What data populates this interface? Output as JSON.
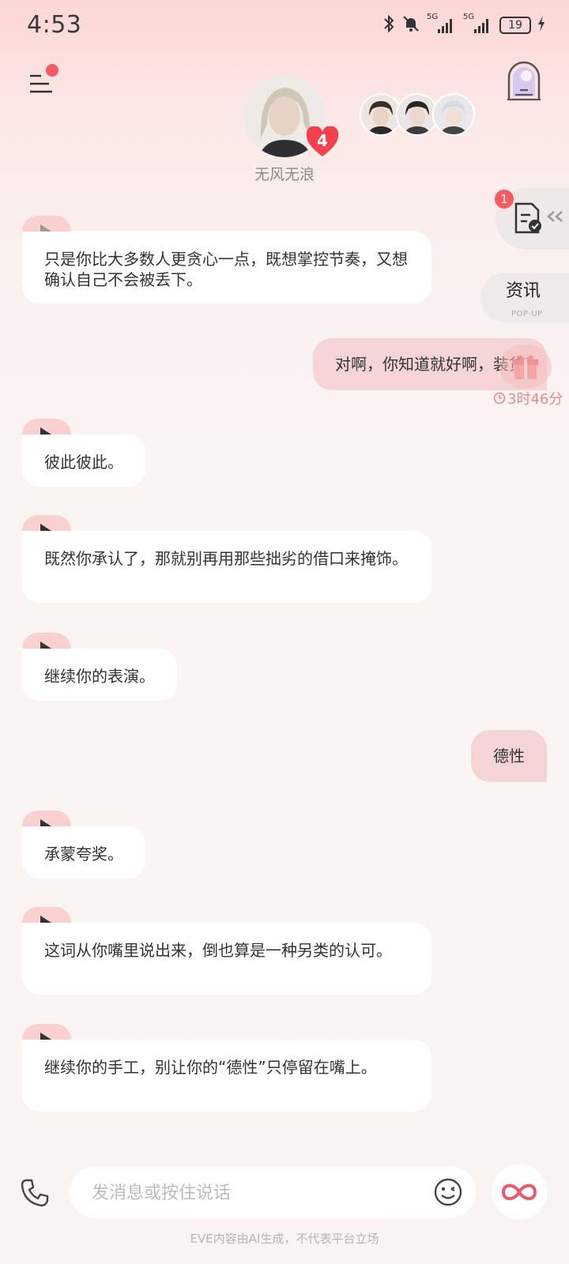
{
  "status_bar": {
    "time": "4:53",
    "battery": "19",
    "signal_1": "5G",
    "signal_2": "5G"
  },
  "header": {
    "character_name": "无风无浪",
    "affinity_level": "4"
  },
  "side": {
    "task_badge": "1",
    "news_label": "资讯",
    "news_sub": "POP-UP",
    "timer": "3时46分"
  },
  "messages": [
    {
      "role": "ai",
      "text": "只是你比大多数人更贪心一点，既想掌控节奏，又想确认自己不会被丢下。"
    },
    {
      "role": "user",
      "text": "对啊，你知道就好啊，装货"
    },
    {
      "role": "ai",
      "text": "彼此彼此。"
    },
    {
      "role": "ai",
      "text": "既然你承认了，那就别再用那些拙劣的借口来掩饰。"
    },
    {
      "role": "ai",
      "text": "继续你的表演。"
    },
    {
      "role": "user",
      "text": "德性"
    },
    {
      "role": "ai",
      "text": "承蒙夸奖。"
    },
    {
      "role": "ai",
      "text": "这词从你嘴里说出来，倒也算是一种另类的认可。"
    },
    {
      "role": "ai",
      "text": "继续你的手工，别让你的“德性”只停留在嘴上。"
    }
  ],
  "input": {
    "placeholder": "发消息或按住说话",
    "value": ""
  },
  "footer": {
    "disclaimer": "EVE内容由AI生成，不代表平台立场"
  },
  "colors": {
    "accent": "#f45b63",
    "ai_tab": "#fbd0d0",
    "user_bubble": "#f4d4d4",
    "background": "#faf5f3"
  },
  "icons": [
    "menu-icon",
    "portal-door-icon",
    "task-check-icon",
    "gift-icon",
    "clock-icon",
    "play-icon",
    "phone-icon",
    "emoji-wink-icon",
    "infinity-icon",
    "bluetooth-icon",
    "mute-bell-icon",
    "battery-icon"
  ]
}
